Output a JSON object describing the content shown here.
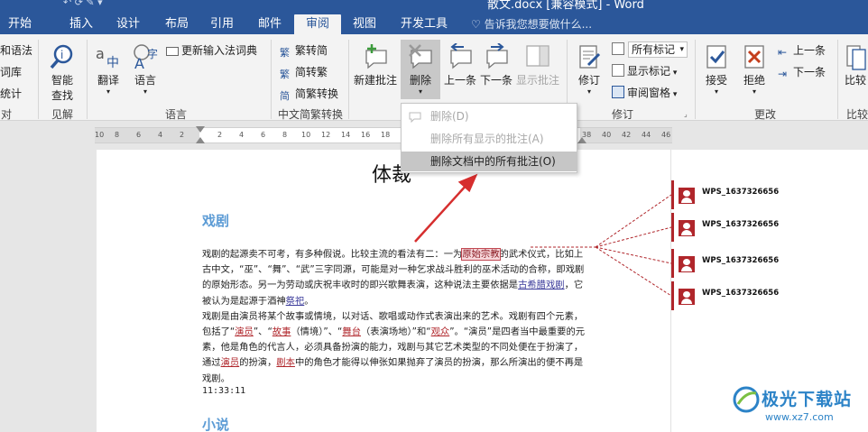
{
  "window": {
    "title": "散文.docx [兼容模式] - Word",
    "tell_me": "告诉我您想要做什么..."
  },
  "tabs": [
    "开始",
    "插入",
    "设计",
    "布局",
    "引用",
    "邮件",
    "审阅",
    "视图",
    "开发工具"
  ],
  "active_tab": "审阅",
  "ribbon": {
    "proofing": {
      "grammar": "和语法",
      "thesaurus": "词库",
      "stats": "统计",
      "label": "对"
    },
    "insights": {
      "smart_lookup_1": "智能",
      "smart_lookup_2": "查找",
      "label": "见解"
    },
    "language": {
      "translate": "翻译",
      "language": "语言",
      "update_ime": "更新输入法词典",
      "label": "语言"
    },
    "chinese": {
      "trad_to_simp": "繁转简",
      "simp_to_trad": "简转繁",
      "convert": "简繁转换",
      "label": "中文简繁转换"
    },
    "comments": {
      "new": "新建批注",
      "delete": "删除",
      "prev": "上一条",
      "next": "下一条",
      "show": "显示批注"
    },
    "tracking": {
      "track": "修订",
      "markup_combo": "所有标记",
      "show_markup": "显示标记",
      "review_pane": "审阅窗格",
      "label": "修订"
    },
    "changes": {
      "accept": "接受",
      "reject": "拒绝",
      "prev": "上一条",
      "next": "下一条",
      "label": "更改"
    },
    "compare": {
      "compare": "比较",
      "label": "比较"
    }
  },
  "delete_menu": {
    "items": [
      {
        "label": "删除(D)",
        "enabled": false
      },
      {
        "label": "删除所有显示的批注(A)",
        "enabled": false
      },
      {
        "label": "删除文档中的所有批注(O)",
        "enabled": true
      }
    ]
  },
  "ruler": {
    "ticks": [
      "10",
      "8",
      "6",
      "4",
      "2",
      "2",
      "4",
      "6",
      "8",
      "10",
      "12",
      "14",
      "16",
      "18",
      "20",
      "36",
      "38",
      "40",
      "42",
      "44",
      "46"
    ]
  },
  "document": {
    "title": "体裁",
    "section1": "戏剧",
    "para1_a": "戏剧的起源卖不可考，有多种假说。比较主流的看法有二：一为",
    "para1_hl": "原始宗教",
    "para1_b": "的武术仪式，比如上古中文，“巫”、“舞”、“武”三字同源，可能是对一种乞求战斗胜利的巫术活动的合称，即戏剧的原始形态。另一为劳动或庆祝丰收时的即兴歌舞表演，这种说法主要依据是",
    "para1_link1": "古希腊戏剧",
    "para1_c": "，它被认为是起源于酒神",
    "para1_link2": "祭祀",
    "para1_d": "。",
    "para2_a": "戏剧是由演员将某个故事或情境，以对话、歌唱或动作式表演出来的艺术。戏剧有四个元素，包括了“",
    "para2_u1": "演员",
    "para2_b": "”、“",
    "para2_u2": "故事",
    "para2_c": "（情境）”、“",
    "para2_u3": "舞台",
    "para2_d": "（表演场地）”和“",
    "para2_u4": "观众",
    "para2_e": "”。“演员”是四者当中最重要的元素，他是角色的代言人，必须具备扮演的能力，戏剧与其它艺术类型的不同处便在于扮演了，通过",
    "para2_u5": "演员",
    "para2_f": "的扮演，",
    "para2_u6": "剧本",
    "para2_g": "中的角色才能得以伸张如果抛弃了演员的扮演，那么所演出的便不再是戏剧。",
    "time": "11:33:11",
    "section2": "小说"
  },
  "comments": [
    {
      "author": "WPS_1637326656"
    },
    {
      "author": "WPS_1637326656"
    },
    {
      "author": "WPS_1637326656"
    },
    {
      "author": "WPS_1637326656"
    }
  ],
  "watermark": {
    "brand": "极光下载站",
    "url": "www.xz7.com"
  },
  "colors": {
    "word_blue": "#2b579a",
    "comment_red": "#b0262b",
    "heading_blue": "#5b9bd5"
  }
}
